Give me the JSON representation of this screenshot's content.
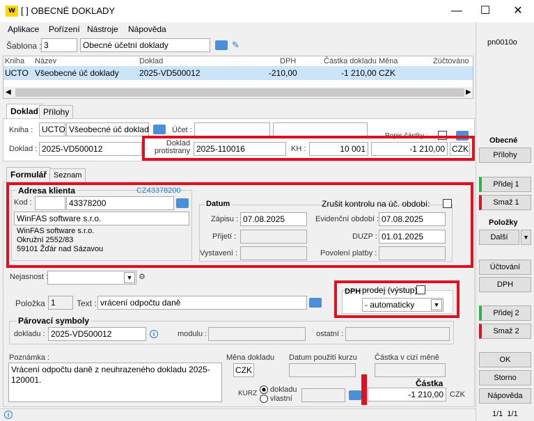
{
  "window": {
    "logo": "W",
    "title": "[                    ] OBECNÉ DOKLADY",
    "minimize": "—",
    "maximize": "☐",
    "close": "✕"
  },
  "menu": [
    "Aplikace",
    "Pořízení",
    "Nástroje",
    "Nápověda"
  ],
  "header": {
    "sablona_label": "Šablona :",
    "sablona_code": "3",
    "sablona_name": "Obecné účetní doklady"
  },
  "grid": {
    "columns": [
      "Kniha",
      "Název",
      "Doklad",
      "DPH",
      "Částka dokladu",
      "Měna",
      "Zúčtováno"
    ],
    "row": [
      "UCTO",
      "Všeobecné úč doklady",
      "2025-VD500012",
      "-210,00",
      "-1 210,00",
      "CZK",
      ""
    ]
  },
  "tabs1": [
    "Doklad",
    "Přílohy"
  ],
  "doklad": {
    "kniha_label": "Kniha :",
    "kniha_code": "UCTO",
    "kniha_name": "Všeobecné úč doklad",
    "ucet_label": "Účet :",
    "ucet_value": "",
    "doklad_label": "Doklad :",
    "doklad_value": "2025-VD500012",
    "protistrany_label1": "Doklad",
    "protistrany_label2": "protistrany",
    "protistrany_value": "2025-110016",
    "kh_label": "KH :",
    "kh_value": "10 001",
    "amount": "-1 210,00",
    "currency": "CZK",
    "cut_label": "Popis částky :"
  },
  "tabs2": [
    "Formulář",
    "Seznam"
  ],
  "adresa": {
    "title": "Adresa klienta",
    "cz": "CZ43378200",
    "kod_label": "Kod :",
    "kod_value": "",
    "ico": "43378200",
    "name": "WinFAS software s.r.o.",
    "addr1": "WinFAS software s.r.o.",
    "addr2": "Okružní 2552/83",
    "addr3": "59101 Žďár nad Sázavou"
  },
  "datum": {
    "title": "Datum",
    "zrusit_label": "Zrušit kontrolu na úč. období:",
    "zapisu_label": "Zápisu :",
    "zapisu": "07.08.2025",
    "evid_label": "Evidenční období :",
    "evid": "07.08.2025",
    "prijeti_label": "Přijetí :",
    "prijeti": "",
    "duzp_label": "DUZP :",
    "duzp": "01.01.2025",
    "vystaveni_label": "Vystavení :",
    "vystaveni": "",
    "povoleni_label": "Povolení platby :",
    "povoleni": ""
  },
  "form": {
    "nejasnost_label": "Nejasnost :",
    "polozka_label": "Položka :",
    "polozka": "1",
    "text_label": "Text :",
    "text": "vrácení odpočtu daně",
    "dph_label": "DPH",
    "prodej_label": "prodej (výstup)",
    "dph_mode": "- automaticky",
    "parovaci_title": "Párovací symboly",
    "dokladu_label": "dokladu :",
    "dokladu": "2025-VD500012",
    "modulu_label": "modulu :",
    "ostatni_label": "ostatní :",
    "poznamka_label": "Poznámka :",
    "poznamka": "Vrácení odpočtu daně z neuhrazeného dokladu 2025-120001.",
    "mena_label": "Měna dokladu",
    "mena": "CZK",
    "datum_kurzu_label": "Datum použití kurzu",
    "castka_cizi_label": "Částka v cizí měně",
    "kurz_label": "KURZ",
    "radio1": "dokladu",
    "radio2": "vlastní",
    "castka_label": "Částka",
    "castka": "-1 210,00",
    "castka_cur": "CZK"
  },
  "side": {
    "code": "pn0010o",
    "obecne": "Obecné",
    "prilohy": "Přílohy",
    "pridej1": "Přidej 1",
    "smaz1": "Smaž 1",
    "polozky": "Položky",
    "dalsi": "Další",
    "uctovani": "Účtování",
    "dph": "DPH",
    "pridej2": "Přidej 2",
    "smaz2": "Smaž 2",
    "ok": "OK",
    "storno": "Storno",
    "napoveda": "Nápověda",
    "pager": "1/1  1/1"
  },
  "colors": {
    "highlight": "#e0101e",
    "selection": "#cce4f7",
    "link": "#2a7bd0"
  }
}
